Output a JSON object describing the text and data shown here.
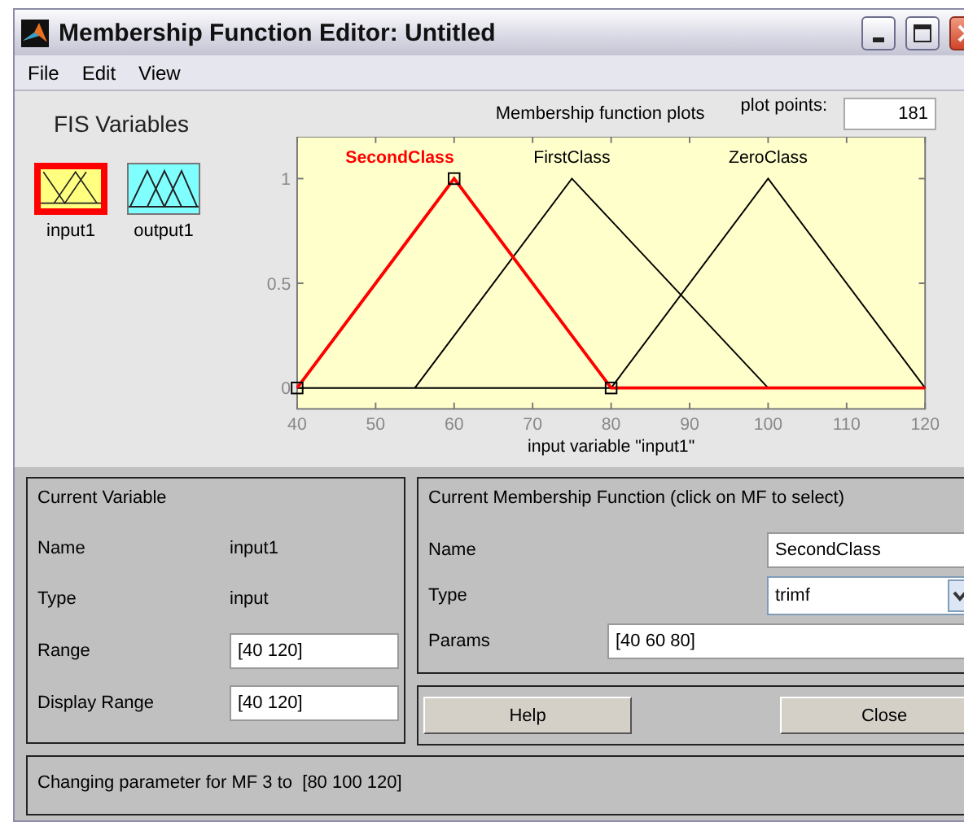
{
  "window": {
    "title": "Membership Function Editor: Untitled"
  },
  "menu": [
    "File",
    "Edit",
    "View"
  ],
  "fis_variables": {
    "title": "FIS Variables",
    "items": [
      {
        "label": "input1",
        "kind": "input",
        "selected": true
      },
      {
        "label": "output1",
        "kind": "output",
        "selected": false
      }
    ]
  },
  "plot": {
    "title": "Membership function plots",
    "plot_points_label": "plot points:",
    "plot_points": "181",
    "chart_data": {
      "type": "line",
      "xlabel": "input variable \"input1\"",
      "x": [
        40,
        55,
        60,
        75,
        80,
        100,
        120
      ],
      "xlim": [
        40,
        120
      ],
      "ylim": [
        -0.1,
        1.2
      ],
      "xticks": [
        40,
        50,
        60,
        70,
        80,
        90,
        100,
        110,
        120
      ],
      "yticks": [
        0,
        0.5,
        1
      ],
      "series": [
        {
          "name": "FirstClass",
          "color": "#000000",
          "values": [
            null,
            0,
            0.25,
            1,
            0.8,
            0,
            null
          ]
        },
        {
          "name": "ZeroClass",
          "color": "#000000",
          "values": [
            null,
            null,
            null,
            null,
            0,
            1,
            0
          ]
        },
        {
          "name": "SecondClass",
          "color": "#ff0000",
          "values": [
            0,
            0.75,
            1,
            0.25,
            0,
            0,
            0
          ]
        }
      ]
    },
    "mfs": [
      {
        "selected": false
      },
      {
        "selected": false
      },
      {
        "selected": true
      }
    ]
  },
  "current_variable": {
    "title": "Current Variable",
    "name_label": "Name",
    "name": "input1",
    "type_label": "Type",
    "type": "input",
    "range_label": "Range",
    "range": "[40 120]",
    "display_range_label": "Display Range",
    "display_range": "[40 120]"
  },
  "current_mf": {
    "title": "Current Membership Function (click on MF to select)",
    "name_label": "Name",
    "name": "SecondClass",
    "type_label": "Type",
    "type": "trimf",
    "params_label": "Params",
    "params": "[40 60 80]"
  },
  "buttons": [
    "Help",
    "Close"
  ],
  "status": "Changing parameter for MF 3 to  [80 100 120]"
}
